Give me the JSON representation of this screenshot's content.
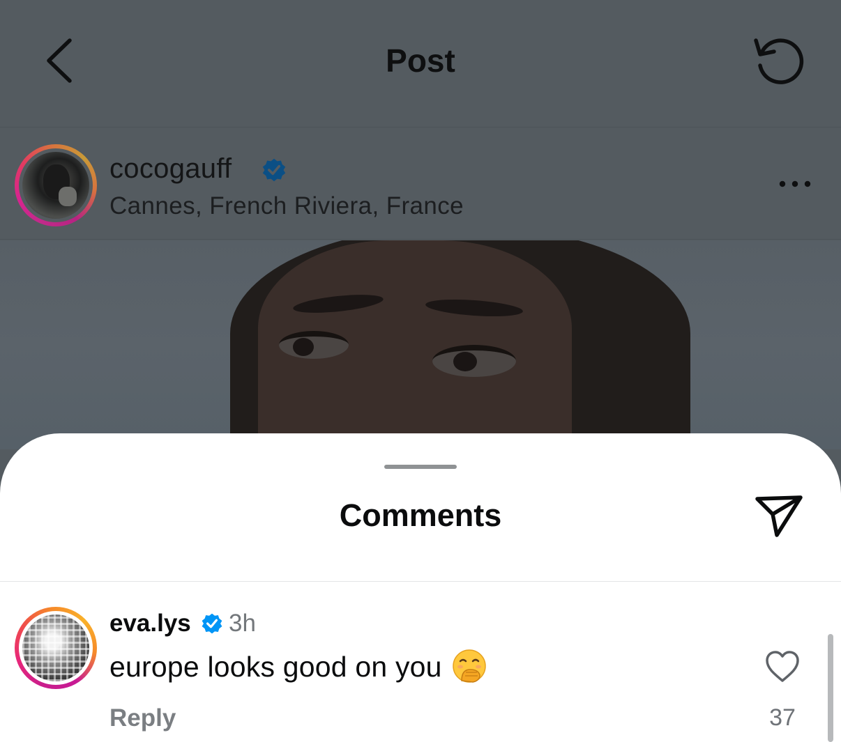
{
  "header": {
    "title": "Post",
    "back_icon": "chevron-left-icon",
    "refresh_icon": "refresh-icon"
  },
  "post": {
    "username": "cocogauff",
    "verified": true,
    "location": "Cannes, French Riviera, France",
    "more_icon": "more-horizontal-icon"
  },
  "comments_sheet": {
    "title": "Comments",
    "share_icon": "send-icon"
  },
  "comments": [
    {
      "username": "eva.lys",
      "verified": true,
      "time": "3h",
      "text": "europe looks good on you",
      "emoji": "face-with-hand-over-mouth",
      "reply_label": "Reply",
      "likes": "37"
    }
  ],
  "colors": {
    "verified_blue": "#0095f6",
    "dim_overlay": "#545b60",
    "secondary_text": "#73777b"
  }
}
